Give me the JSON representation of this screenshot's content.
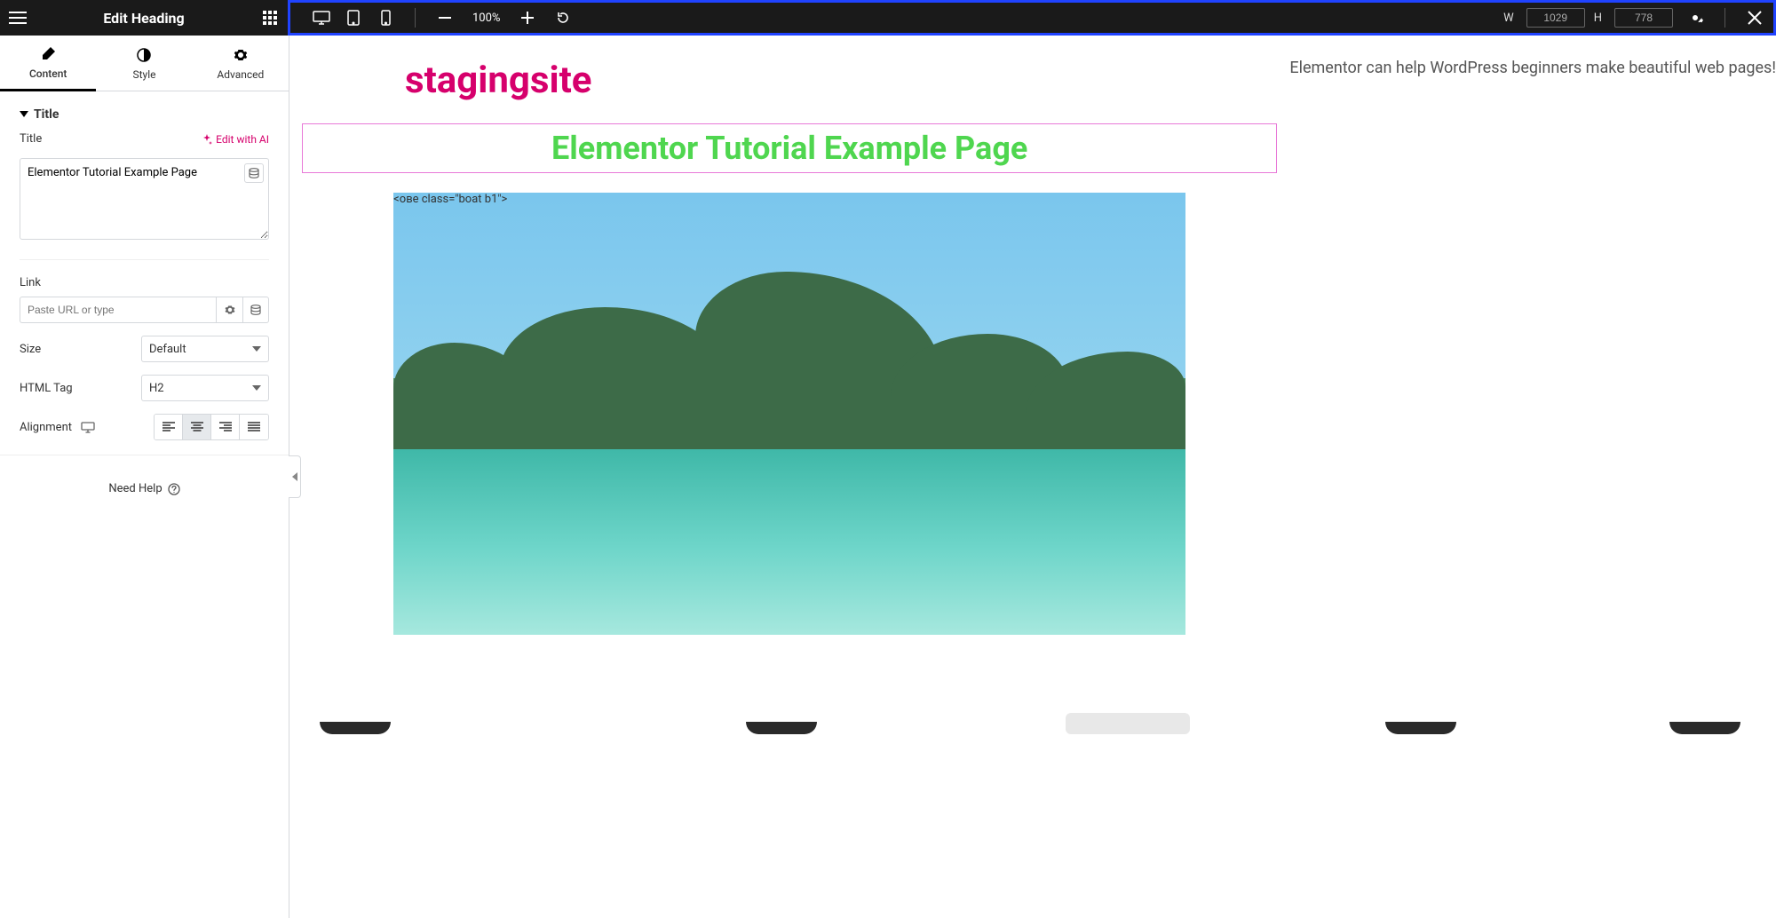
{
  "topbar": {
    "title": "Edit Heading",
    "zoom": "100%",
    "width_label": "W",
    "width_value": "1029",
    "height_label": "H",
    "height_value": "778"
  },
  "tabs": {
    "content": "Content",
    "style": "Style",
    "advanced": "Advanced"
  },
  "section_title": {
    "header": "Title",
    "title_label": "Title",
    "edit_ai": "Edit with AI",
    "title_value": "Elementor Tutorial Example Page",
    "link_label": "Link",
    "link_placeholder": "Paste URL or type",
    "size_label": "Size",
    "size_value": "Default",
    "html_tag_label": "HTML Tag",
    "html_tag_value": "H2",
    "alignment_label": "Alignment"
  },
  "footer": {
    "need_help": "Need Help"
  },
  "canvas": {
    "site_title": "stagingsite",
    "heading": "Elementor Tutorial Example Page",
    "caption": "Elementor can help WordPress beginners make beautiful web pages!"
  }
}
